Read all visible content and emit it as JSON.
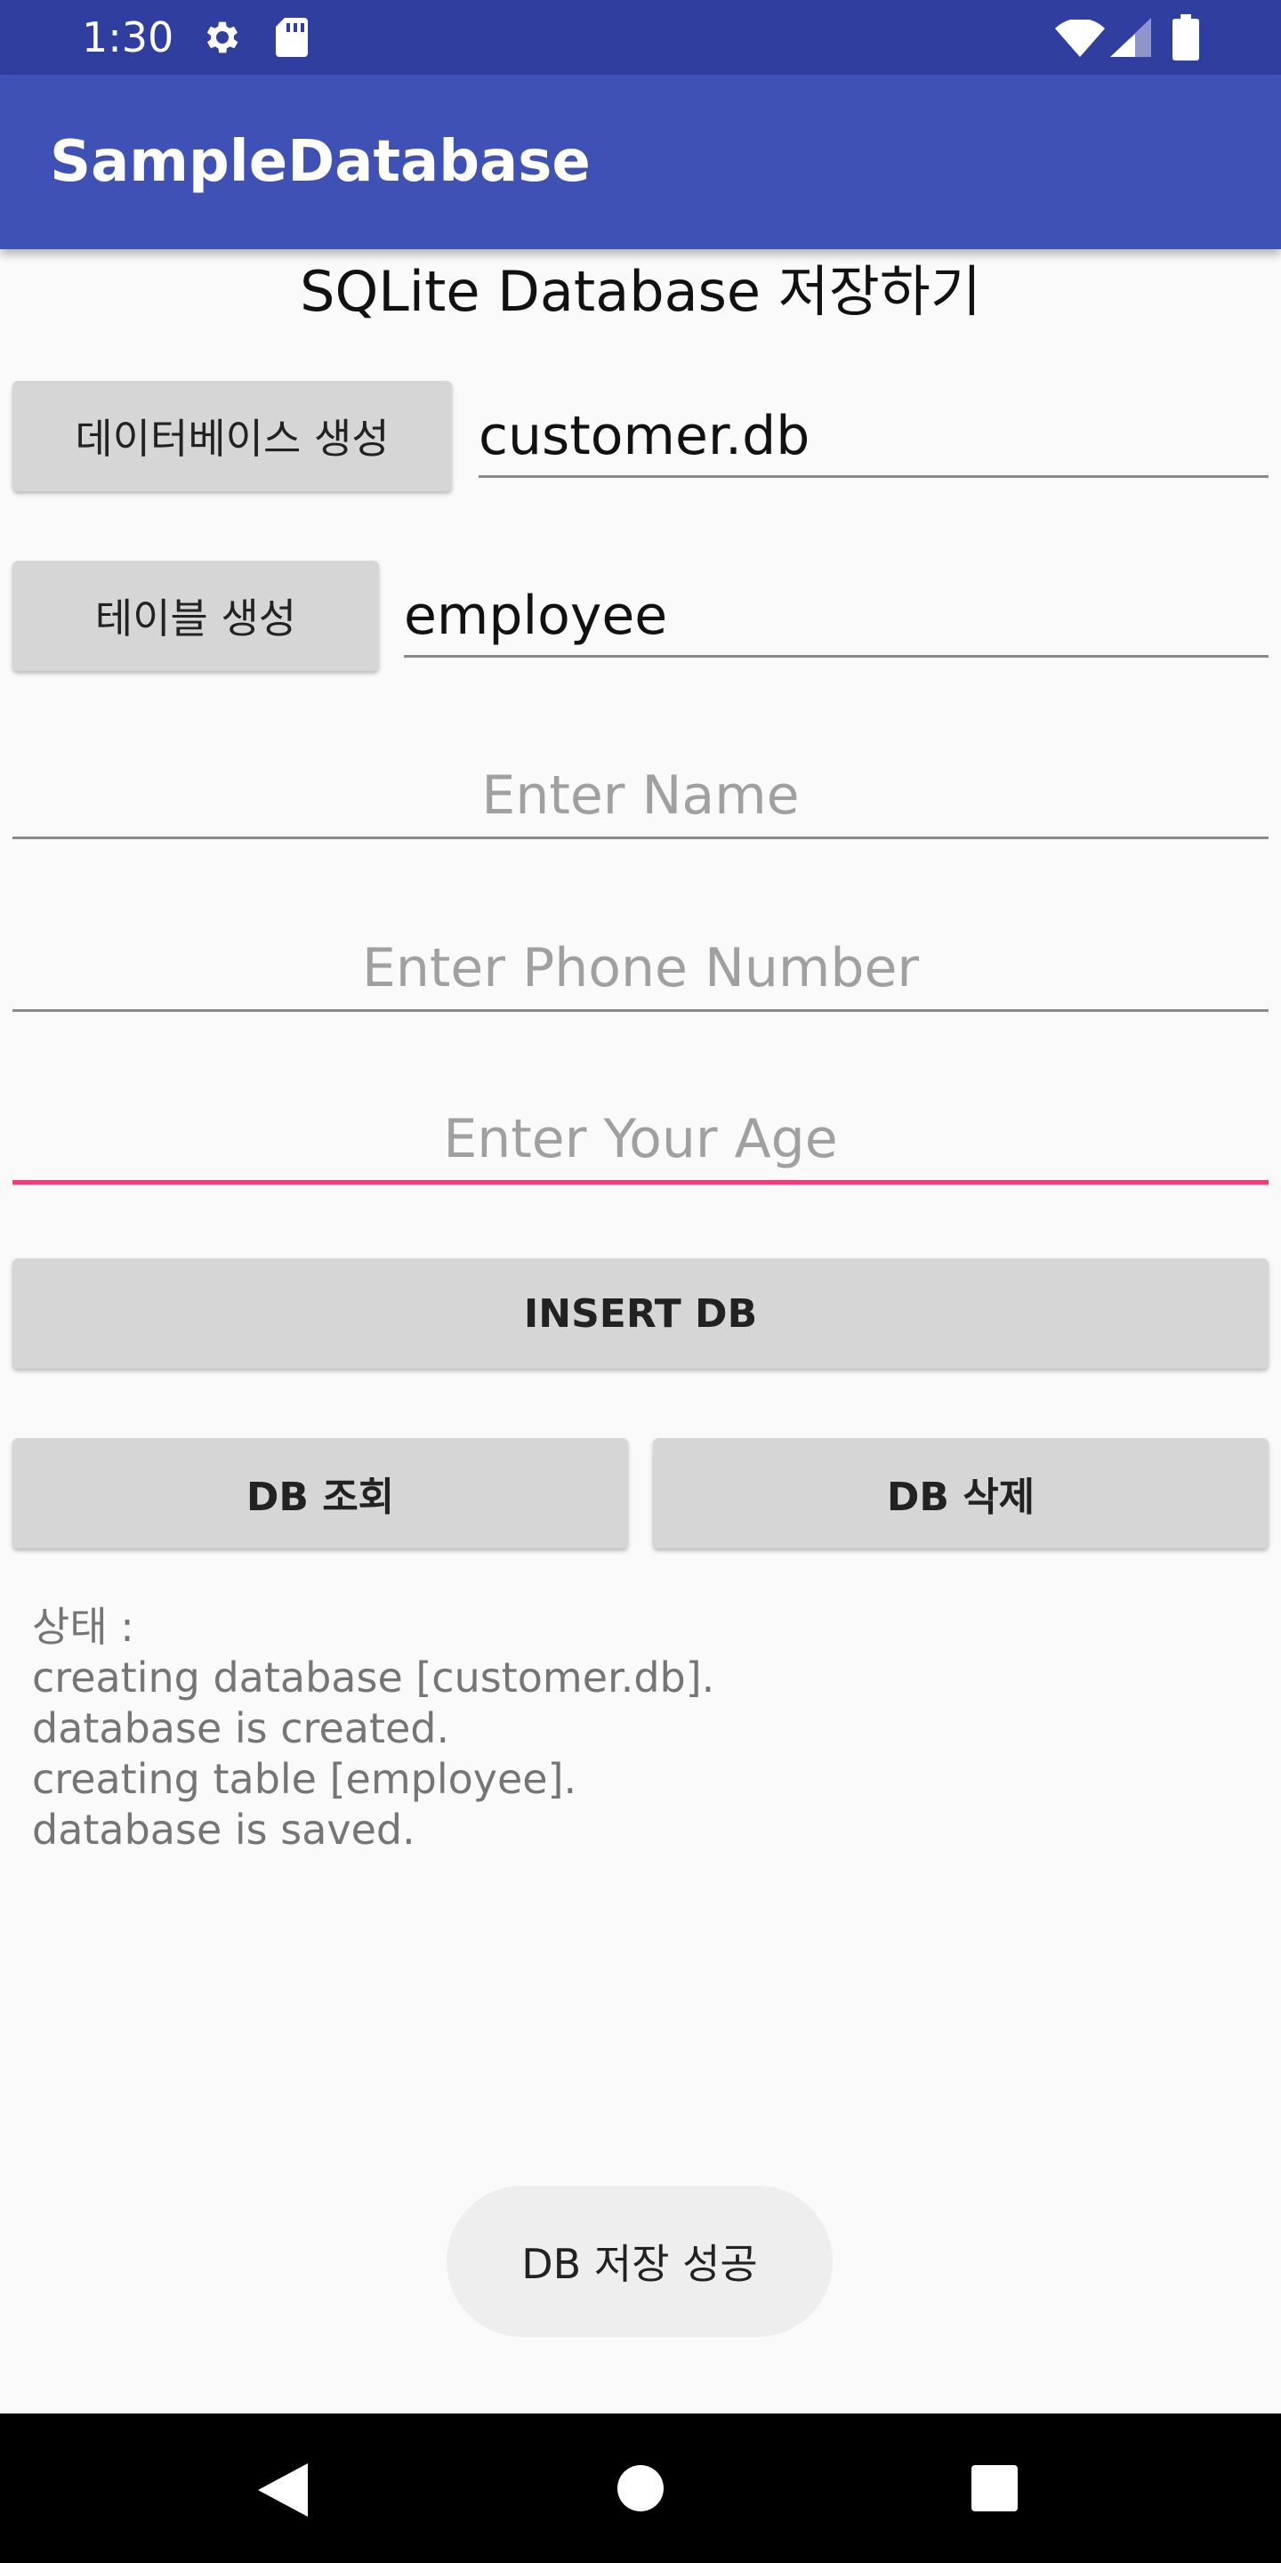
{
  "status_bar": {
    "time": "1:30"
  },
  "app_bar": {
    "title": "SampleDatabase"
  },
  "heading": "SQLite Database 저장하기",
  "create_db": {
    "button_label": "데이터베이스 생성",
    "value": "customer.db"
  },
  "create_table": {
    "button_label": "테이블 생성",
    "value": "employee"
  },
  "fields": {
    "name_placeholder": "Enter Name",
    "phone_placeholder": "Enter Phone Number",
    "age_placeholder": "Enter Your Age"
  },
  "buttons": {
    "insert": "INSERT DB",
    "query": "DB 조회",
    "delete": "DB 삭제"
  },
  "status": {
    "label": "상태 :",
    "lines": "creating database [customer.db].\ndatabase is created.\ncreating table [employee].\ndatabase is saved."
  },
  "toast": "DB 저장 성공",
  "colors": {
    "status_bar": "#303f9f",
    "app_bar": "#3f51b5",
    "accent": "#ec407a"
  },
  "icons": [
    "settings-icon",
    "sd-card-icon",
    "wifi-icon",
    "signal-icon",
    "battery-icon",
    "back-icon",
    "home-icon",
    "recents-icon"
  ]
}
